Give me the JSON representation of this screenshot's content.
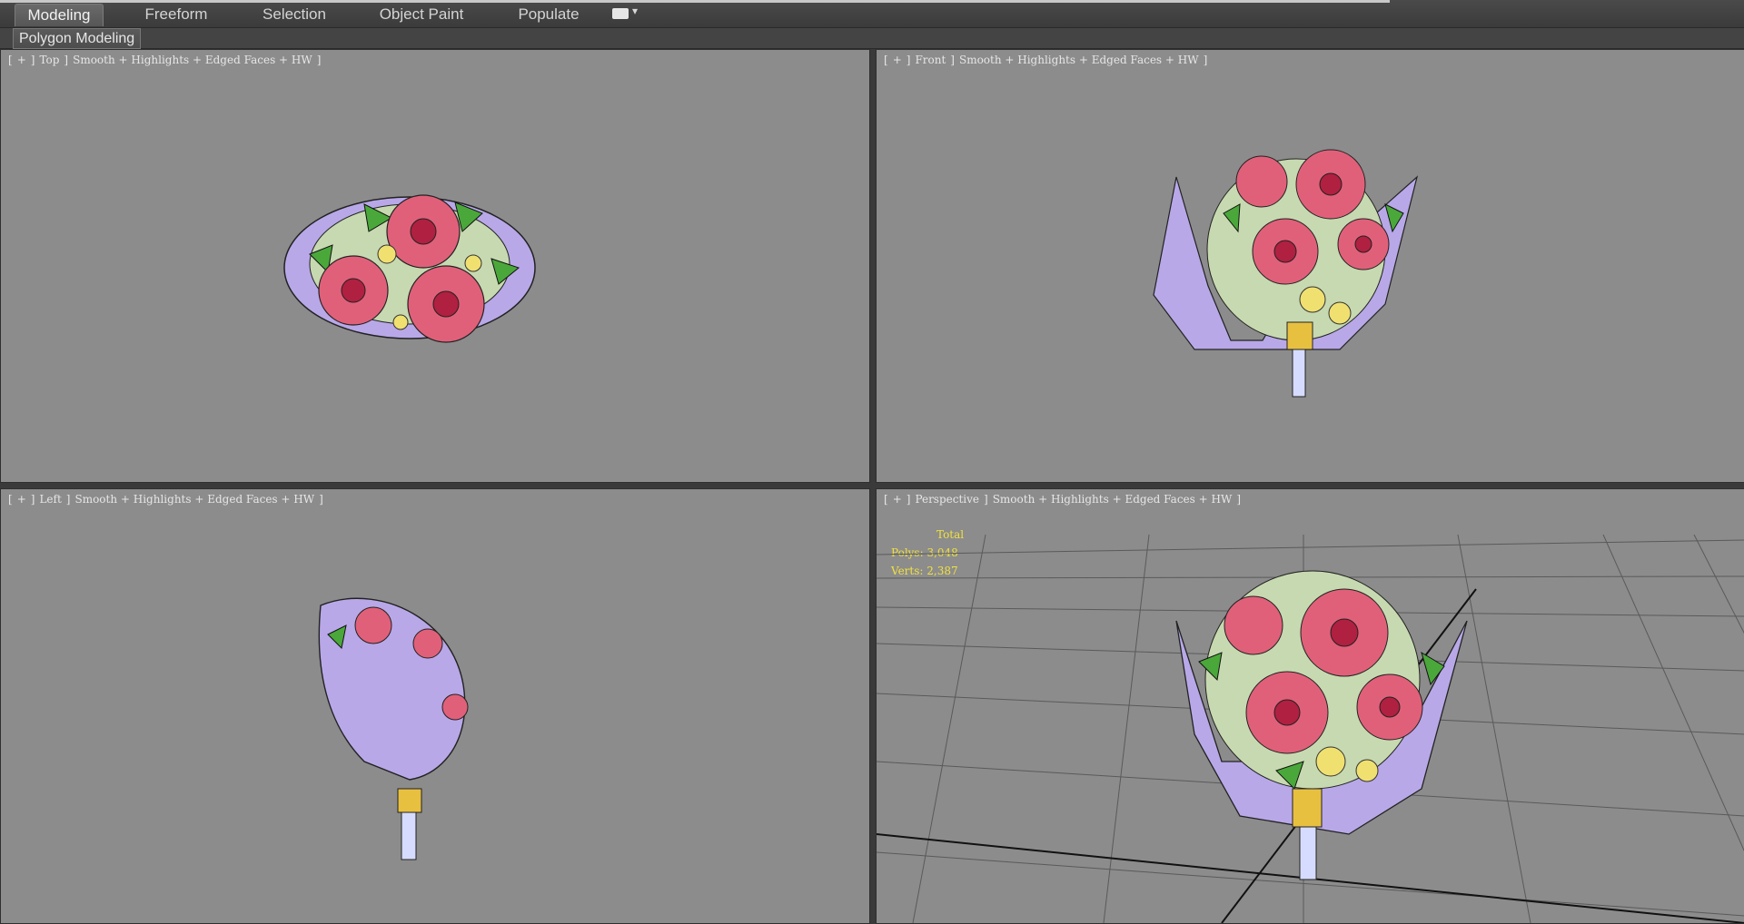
{
  "ribbon": {
    "tabs": [
      "Modeling",
      "Freeform",
      "Selection",
      "Object Paint",
      "Populate"
    ],
    "active_tab": "Modeling",
    "subtab": "Polygon Modeling"
  },
  "viewports": [
    {
      "id": "top",
      "bracket_open": "[",
      "plus": "+",
      "marker": "]",
      "name": "Top",
      "marker2": "]",
      "shading": "Smooth + Highlights + Edged Faces + HW",
      "bracket_close": "]"
    },
    {
      "id": "front",
      "bracket_open": "[",
      "plus": "+",
      "marker": "]",
      "name": "Front",
      "marker2": "]",
      "shading": "Smooth + Highlights + Edged Faces + HW",
      "bracket_close": "]"
    },
    {
      "id": "left",
      "bracket_open": "[",
      "plus": "+",
      "marker": "]",
      "name": "Left",
      "marker2": "]",
      "shading": "Smooth + Highlights + Edged Faces + HW",
      "bracket_close": "]"
    },
    {
      "id": "perspective",
      "bracket_open": "[",
      "plus": "+",
      "marker": "]",
      "name": "Perspective",
      "marker2": "]",
      "shading": "Smooth + Highlights + Edged Faces + HW",
      "bracket_close": "]"
    }
  ],
  "stats": {
    "total_label": "Total",
    "polys": "Polys: 3,048",
    "verts": "Verts: 2,387"
  },
  "colors": {
    "viewport_bg": "#8c8c8c",
    "rose": "#e0607a",
    "leaf": "#4aa83a",
    "wrap": "#b8a8e8",
    "ribbon_gold": "#e8c040",
    "stats_text": "#f0e040"
  }
}
